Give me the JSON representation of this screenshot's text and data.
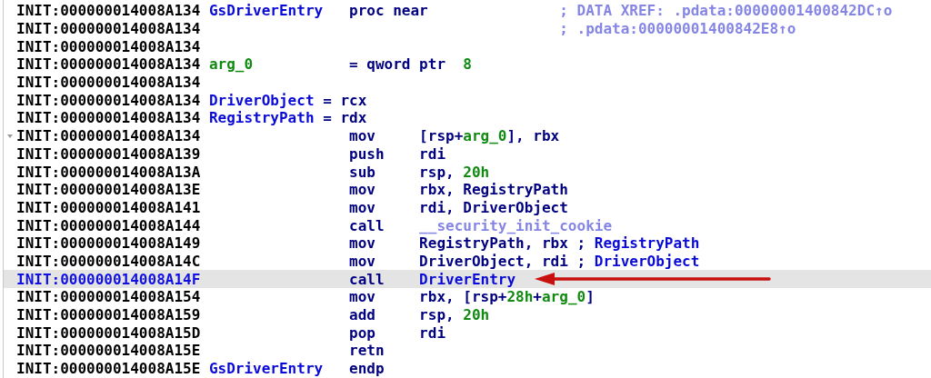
{
  "lines": [
    {
      "address": "INIT:000000014008A134",
      "selected": false,
      "fold": false,
      "label": [
        {
          "kind": "name",
          "text": "GsDriverEntry"
        }
      ],
      "directive": [
        {
          "kind": "text",
          "text": "proc near"
        }
      ],
      "comment": [
        {
          "kind": "lib",
          "text": "; DATA XREF: .pdata:00000001400842DC↑o"
        }
      ]
    },
    {
      "address": "INIT:000000014008A134",
      "selected": false,
      "fold": false,
      "comment": [
        {
          "kind": "lib",
          "text": "; .pdata:00000001400842E8↑o"
        }
      ]
    },
    {
      "address": "INIT:000000014008A134",
      "selected": false,
      "fold": false
    },
    {
      "address": "INIT:000000014008A134",
      "selected": false,
      "fold": false,
      "label": [
        {
          "kind": "num",
          "text": "arg_0"
        }
      ],
      "directive": [
        {
          "kind": "text",
          "text": "= qword ptr  "
        },
        {
          "kind": "num",
          "text": "8"
        }
      ]
    },
    {
      "address": "INIT:000000014008A134",
      "selected": false,
      "fold": false
    },
    {
      "address": "INIT:000000014008A134",
      "selected": false,
      "fold": false,
      "label": [
        {
          "kind": "name",
          "text": "DriverObject"
        },
        {
          "kind": "text",
          "text": " = rcx"
        }
      ]
    },
    {
      "address": "INIT:000000014008A134",
      "selected": false,
      "fold": false,
      "label": [
        {
          "kind": "name",
          "text": "RegistryPath"
        },
        {
          "kind": "text",
          "text": " = rdx"
        }
      ]
    },
    {
      "address": "INIT:000000014008A134",
      "selected": false,
      "fold": true,
      "mnemonic": "mov",
      "operands": [
        {
          "kind": "text",
          "text": "[rsp+"
        },
        {
          "kind": "num",
          "text": "arg_0"
        },
        {
          "kind": "text",
          "text": "], rbx"
        }
      ]
    },
    {
      "address": "INIT:000000014008A139",
      "selected": false,
      "fold": false,
      "mnemonic": "push",
      "operands": [
        {
          "kind": "text",
          "text": "rdi"
        }
      ]
    },
    {
      "address": "INIT:000000014008A13A",
      "selected": false,
      "fold": false,
      "mnemonic": "sub",
      "operands": [
        {
          "kind": "text",
          "text": "rsp, "
        },
        {
          "kind": "num",
          "text": "20h"
        }
      ]
    },
    {
      "address": "INIT:000000014008A13E",
      "selected": false,
      "fold": false,
      "mnemonic": "mov",
      "operands": [
        {
          "kind": "text",
          "text": "rbx, RegistryPath"
        }
      ]
    },
    {
      "address": "INIT:000000014008A141",
      "selected": false,
      "fold": false,
      "mnemonic": "mov",
      "operands": [
        {
          "kind": "text",
          "text": "rdi, DriverObject"
        }
      ]
    },
    {
      "address": "INIT:000000014008A144",
      "selected": false,
      "fold": false,
      "mnemonic": "call",
      "operands": [
        {
          "kind": "lib",
          "text": "__security_init_cookie"
        }
      ]
    },
    {
      "address": "INIT:000000014008A149",
      "selected": false,
      "fold": false,
      "mnemonic": "mov",
      "operands": [
        {
          "kind": "text",
          "text": "RegistryPath, rbx"
        }
      ],
      "comment": [
        {
          "kind": "text",
          "text": "; "
        },
        {
          "kind": "name",
          "text": "RegistryPath"
        }
      ]
    },
    {
      "address": "INIT:000000014008A14C",
      "selected": false,
      "fold": false,
      "mnemonic": "mov",
      "operands": [
        {
          "kind": "text",
          "text": "DriverObject, rdi"
        }
      ],
      "comment": [
        {
          "kind": "text",
          "text": "; "
        },
        {
          "kind": "name",
          "text": "DriverObject"
        }
      ]
    },
    {
      "address": "INIT:000000014008A14F",
      "selected": true,
      "fold": false,
      "mnemonic": "call",
      "operands": [
        {
          "kind": "name",
          "text": "DriverEntry"
        }
      ]
    },
    {
      "address": "INIT:000000014008A154",
      "selected": false,
      "fold": false,
      "mnemonic": "mov",
      "operands": [
        {
          "kind": "text",
          "text": "rbx, [rsp+"
        },
        {
          "kind": "num",
          "text": "28h"
        },
        {
          "kind": "text",
          "text": "+"
        },
        {
          "kind": "num",
          "text": "arg_0"
        },
        {
          "kind": "text",
          "text": "]"
        }
      ]
    },
    {
      "address": "INIT:000000014008A159",
      "selected": false,
      "fold": false,
      "mnemonic": "add",
      "operands": [
        {
          "kind": "text",
          "text": "rsp, "
        },
        {
          "kind": "num",
          "text": "20h"
        }
      ]
    },
    {
      "address": "INIT:000000014008A15D",
      "selected": false,
      "fold": false,
      "mnemonic": "pop",
      "operands": [
        {
          "kind": "text",
          "text": "rdi"
        }
      ]
    },
    {
      "address": "INIT:000000014008A15E",
      "selected": false,
      "fold": false,
      "mnemonic": "retn"
    },
    {
      "address": "INIT:000000014008A15E",
      "selected": false,
      "fold": false,
      "label": [
        {
          "kind": "name",
          "text": "GsDriverEntry"
        }
      ],
      "directive": [
        {
          "kind": "text",
          "text": "endp"
        }
      ]
    }
  ]
}
